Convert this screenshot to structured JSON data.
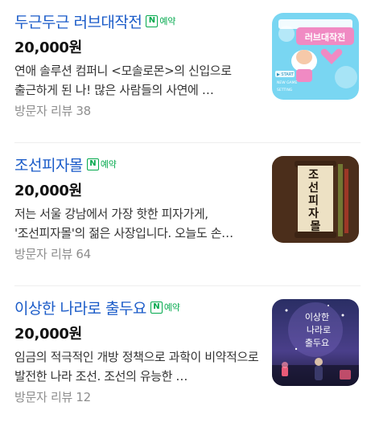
{
  "products": [
    {
      "title": "두근두근 러브대작전",
      "badge_label": "예약",
      "price": "20,000원",
      "description": "연애 솔루션 컴퍼니 <모솔로몬>의 신입으로 출근하게 된 나! 많은 사람들의 사연에 …",
      "review": "방문자 리뷰 38",
      "thumbnail": {
        "icon": "game-poster-love-thumbnail",
        "poster_title": "러브대작전",
        "menu_start": "▶ START",
        "menu_new_game": "NEW GAME",
        "menu_setting": "SETTING",
        "colors": [
          "#79d6f2",
          "#f08ac3",
          "#ffffff"
        ]
      }
    },
    {
      "title": "조선피자몰",
      "badge_label": "예약",
      "price": "20,000원",
      "description": "저는 서울 강남에서 가장 핫한 피자가게, '조선피자몰'의 젊은 사장입니다. 오늘도 손…",
      "review": "방문자 리뷰 64",
      "thumbnail": {
        "icon": "scroll-thumbnail",
        "scroll_text": "조선피자몰",
        "colors": [
          "#5b3a22",
          "#ede1c4",
          "#3c2414"
        ]
      }
    },
    {
      "title": "이상한 나라로 출두요",
      "badge_label": "예약",
      "price": "20,000원",
      "description": "임금의 적극적인 개방 정책으로 과학이 비약적으로 발전한 나라 조선. 조선의 유능한 …",
      "review": "방문자 리뷰 12",
      "thumbnail": {
        "icon": "night-scene-thumbnail",
        "poster_title_lines": [
          "이상한",
          "나라로",
          "출두요"
        ],
        "colors": [
          "#2a2e64",
          "#7c6bc4",
          "#e85a78"
        ]
      }
    }
  ],
  "accent_colors": {
    "title": "#1a5bc8",
    "naver_badge": "#03a94d",
    "review": "#8e8e8e"
  }
}
